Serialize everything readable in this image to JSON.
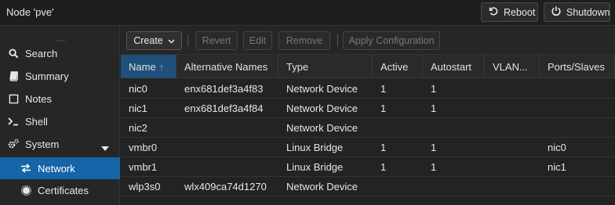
{
  "header": {
    "title": "Node 'pve'",
    "reboot_label": "Reboot",
    "shutdown_label": "Shutdown"
  },
  "sidebar": {
    "items": [
      {
        "label": "Search",
        "icon": "search-icon"
      },
      {
        "label": "Summary",
        "icon": "book-icon"
      },
      {
        "label": "Notes",
        "icon": "note-icon"
      },
      {
        "label": "Shell",
        "icon": "terminal-icon"
      },
      {
        "label": "System",
        "icon": "gears-icon"
      },
      {
        "label": "Network",
        "icon": "exchange-icon"
      },
      {
        "label": "Certificates",
        "icon": "certificate-icon"
      }
    ]
  },
  "toolbar": {
    "create_label": "Create",
    "revert_label": "Revert",
    "edit_label": "Edit",
    "remove_label": "Remove",
    "apply_label": "Apply Configuration"
  },
  "table": {
    "columns": [
      "Name",
      "Alternative Names",
      "Type",
      "Active",
      "Autostart",
      "VLAN...",
      "Ports/Slaves"
    ],
    "sort_indicator": "↑",
    "rows": [
      [
        "nic0",
        "enx681def3a4f83",
        "Network Device",
        "1",
        "1",
        "",
        ""
      ],
      [
        "nic1",
        "enx681def3a4f84",
        "Network Device",
        "1",
        "1",
        "",
        ""
      ],
      [
        "nic2",
        "",
        "Network Device",
        "",
        "",
        "",
        ""
      ],
      [
        "vmbr0",
        "",
        "Linux Bridge",
        "1",
        "1",
        "",
        "nic0"
      ],
      [
        "vmbr1",
        "",
        "Linux Bridge",
        "1",
        "1",
        "",
        "nic1"
      ],
      [
        "wlp3s0",
        "wlx409ca74d1270",
        "Network Device",
        "",
        "",
        "",
        ""
      ]
    ]
  },
  "colors": {
    "accent": "#1565a8",
    "background": "#232323"
  }
}
